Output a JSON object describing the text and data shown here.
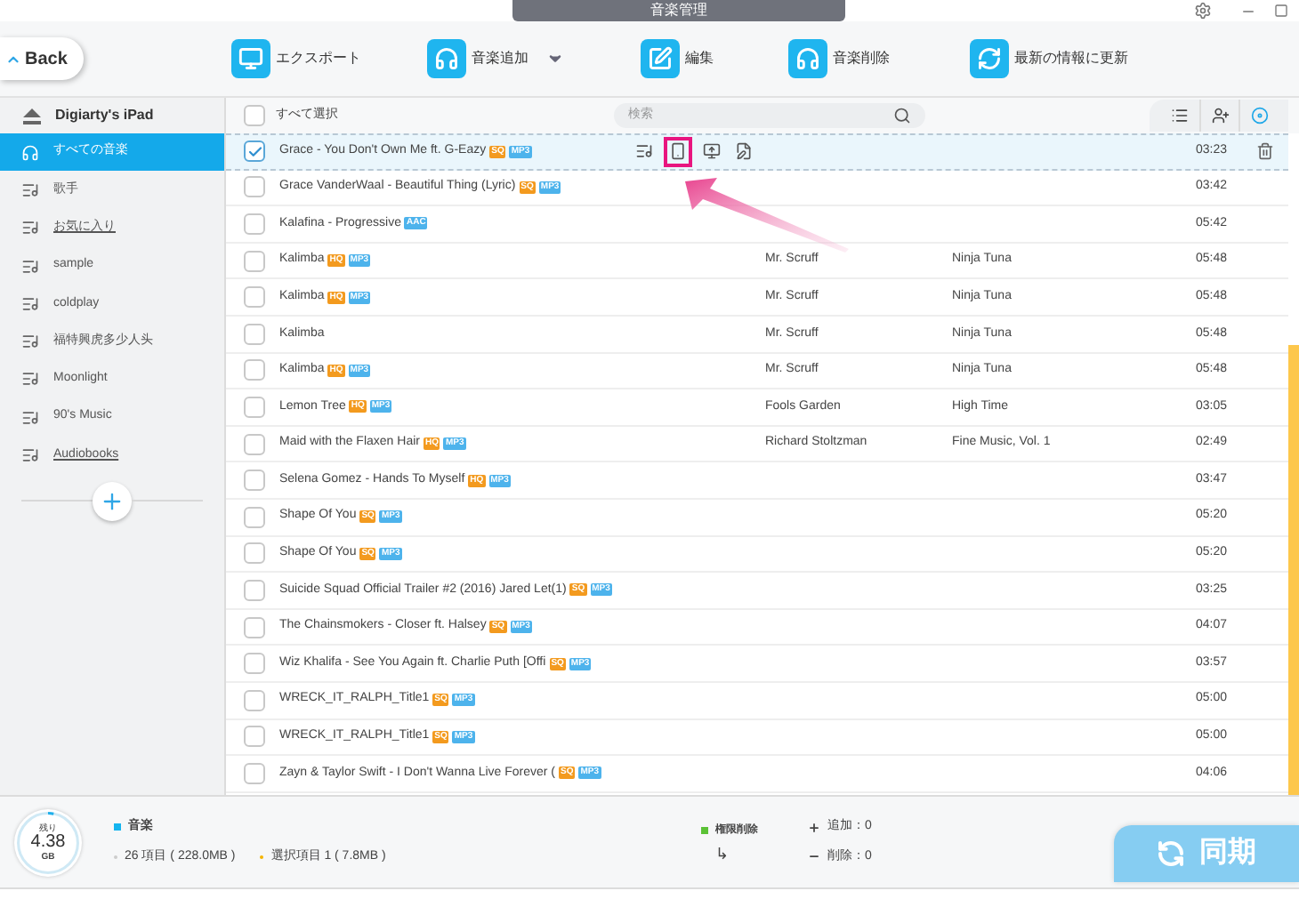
{
  "window": {
    "title": "音楽管理"
  },
  "back_button": "Back",
  "toolbar": [
    {
      "label": "エクスポート",
      "kind": "export",
      "dropdown": false
    },
    {
      "label": "音楽追加",
      "kind": "add",
      "dropdown": true
    },
    {
      "label": "編集",
      "kind": "edit",
      "dropdown": false
    },
    {
      "label": "音楽削除",
      "kind": "delete",
      "dropdown": false
    },
    {
      "label": "最新の情報に更新",
      "kind": "refresh",
      "dropdown": false
    }
  ],
  "sidebar": {
    "device": "Digiarty's iPad",
    "items": [
      {
        "label": "すべての音楽",
        "kind": "all",
        "selected": true,
        "underlined": false
      },
      {
        "label": "歌手",
        "kind": "playlist",
        "selected": false,
        "underlined": false
      },
      {
        "label": "お気に入り",
        "kind": "playlist",
        "selected": false,
        "underlined": true
      },
      {
        "label": "sample",
        "kind": "playlist",
        "selected": false,
        "underlined": false
      },
      {
        "label": "coldplay",
        "kind": "playlist",
        "selected": false,
        "underlined": false
      },
      {
        "label": "福特興虎多少人头",
        "kind": "playlist",
        "selected": false,
        "underlined": false
      },
      {
        "label": "Moonlight",
        "kind": "playlist",
        "selected": false,
        "underlined": false
      },
      {
        "label": "90's Music",
        "kind": "playlist",
        "selected": false,
        "underlined": false
      },
      {
        "label": "Audiobooks",
        "kind": "playlist",
        "selected": false,
        "underlined": true
      }
    ]
  },
  "list_header": {
    "select_all": "すべて選択",
    "select_all_checked": false,
    "search": {
      "placeholder": "検索"
    },
    "views": [
      {
        "kind": "list",
        "selected": false
      },
      {
        "kind": "person",
        "selected": false
      },
      {
        "kind": "disc",
        "selected": true
      }
    ]
  },
  "tracks": [
    {
      "title": "Grace - You Don't Own Me ft. G-Eazy",
      "tags": [
        {
          "label": "SQ",
          "color": "#f39a1e"
        },
        {
          "label": "MP3",
          "color": "#4db3ec"
        }
      ],
      "duration": "03:23",
      "checked": true,
      "selected": true
    },
    {
      "title": "Grace VanderWaal - Beautiful Thing (Lyric)",
      "tags": [
        {
          "label": "SQ",
          "color": "#f39a1e"
        },
        {
          "label": "MP3",
          "color": "#4db3ec"
        }
      ],
      "duration": "03:42",
      "checked": false,
      "selected": false
    },
    {
      "title": "Kalafina - Progressive",
      "tags": [
        {
          "label": "AAC",
          "color": "#4db3ec"
        }
      ],
      "duration": "05:42",
      "checked": false,
      "selected": false
    },
    {
      "title": "Kalimba",
      "tags": [
        {
          "label": "HQ",
          "color": "#f39a1e"
        },
        {
          "label": "MP3",
          "color": "#4db3ec"
        }
      ],
      "artist": "Mr. Scruff",
      "album": "Ninja Tuna",
      "duration": "05:48",
      "checked": false,
      "selected": false
    },
    {
      "title": "Kalimba",
      "tags": [
        {
          "label": "HQ",
          "color": "#f39a1e"
        },
        {
          "label": "MP3",
          "color": "#4db3ec"
        }
      ],
      "artist": "Mr. Scruff",
      "album": "Ninja Tuna",
      "duration": "05:48",
      "checked": false,
      "selected": false
    },
    {
      "title": "Kalimba",
      "artist": "Mr. Scruff",
      "album": "Ninja Tuna",
      "duration": "05:48",
      "checked": false,
      "selected": false
    },
    {
      "title": "Kalimba",
      "tags": [
        {
          "label": "HQ",
          "color": "#f39a1e"
        },
        {
          "label": "MP3",
          "color": "#4db3ec"
        }
      ],
      "artist": "Mr. Scruff",
      "album": "Ninja Tuna",
      "duration": "05:48",
      "checked": false,
      "selected": false
    },
    {
      "title": "Lemon Tree",
      "tags": [
        {
          "label": "HQ",
          "color": "#f39a1e"
        },
        {
          "label": "MP3",
          "color": "#4db3ec"
        }
      ],
      "artist": "Fools Garden",
      "album": "High Time",
      "duration": "03:05",
      "checked": false,
      "selected": false
    },
    {
      "title": "Maid with the Flaxen Hair",
      "tags": [
        {
          "label": "HQ",
          "color": "#f39a1e"
        },
        {
          "label": "MP3",
          "color": "#4db3ec"
        }
      ],
      "artist": "Richard Stoltzman",
      "album": "Fine Music, Vol. 1",
      "duration": "02:49",
      "checked": false,
      "selected": false
    },
    {
      "title": "Selena Gomez - Hands To Myself",
      "tags": [
        {
          "label": "HQ",
          "color": "#f39a1e"
        },
        {
          "label": "MP3",
          "color": "#4db3ec"
        }
      ],
      "duration": "03:47",
      "checked": false,
      "selected": false
    },
    {
      "title": "Shape Of You",
      "tags": [
        {
          "label": "SQ",
          "color": "#f39a1e"
        },
        {
          "label": "MP3",
          "color": "#4db3ec"
        }
      ],
      "duration": "05:20",
      "checked": false,
      "selected": false
    },
    {
      "title": "Shape Of You",
      "tags": [
        {
          "label": "SQ",
          "color": "#f39a1e"
        },
        {
          "label": "MP3",
          "color": "#4db3ec"
        }
      ],
      "duration": "05:20",
      "checked": false,
      "selected": false
    },
    {
      "title": "Suicide Squad Official Trailer #2 (2016) Jared Let(1)",
      "tags": [
        {
          "label": "SQ",
          "color": "#f39a1e"
        },
        {
          "label": "MP3",
          "color": "#4db3ec"
        }
      ],
      "duration": "03:25",
      "checked": false,
      "selected": false
    },
    {
      "title": "The Chainsmokers - Closer ft. Halsey",
      "tags": [
        {
          "label": "SQ",
          "color": "#f39a1e"
        },
        {
          "label": "MP3",
          "color": "#4db3ec"
        }
      ],
      "duration": "04:07",
      "checked": false,
      "selected": false
    },
    {
      "title": "Wiz Khalifa - See You Again ft. Charlie Puth [Offi",
      "tags": [
        {
          "label": "SQ",
          "color": "#f39a1e"
        },
        {
          "label": "MP3",
          "color": "#4db3ec"
        }
      ],
      "duration": "03:57",
      "checked": false,
      "selected": false
    },
    {
      "title": "WRECK_IT_RALPH_Title1",
      "tags": [
        {
          "label": "SQ",
          "color": "#f39a1e"
        },
        {
          "label": "MP3",
          "color": "#4db3ec"
        }
      ],
      "duration": "05:00",
      "checked": false,
      "selected": false
    },
    {
      "title": "WRECK_IT_RALPH_Title1",
      "tags": [
        {
          "label": "SQ",
          "color": "#f39a1e"
        },
        {
          "label": "MP3",
          "color": "#4db3ec"
        }
      ],
      "duration": "05:00",
      "checked": false,
      "selected": false
    },
    {
      "title": "Zayn & Taylor Swift - I Don't Wanna Live Forever (",
      "tags": [
        {
          "label": "SQ",
          "color": "#f39a1e"
        },
        {
          "label": "MP3",
          "color": "#4db3ec"
        }
      ],
      "duration": "04:06",
      "checked": false,
      "selected": false
    }
  ],
  "row_actions": [
    {
      "kind": "playlist",
      "highlighted": false
    },
    {
      "kind": "device",
      "highlighted": true
    },
    {
      "kind": "export",
      "highlighted": false
    },
    {
      "kind": "edit",
      "highlighted": false
    }
  ],
  "status_bar": {
    "storage": {
      "caption": "残り",
      "value": "4.38",
      "unit": "GB",
      "level": 0.03
    },
    "category": "音楽",
    "items": "26 項目 ( 228.0MB )",
    "selected_items": "選択項目 1 ( 7.8MB )",
    "permission": "権限削除",
    "arrow": "↳",
    "added_label": "追加：0",
    "removed_label": "削除：0",
    "sync_button": "同期"
  }
}
